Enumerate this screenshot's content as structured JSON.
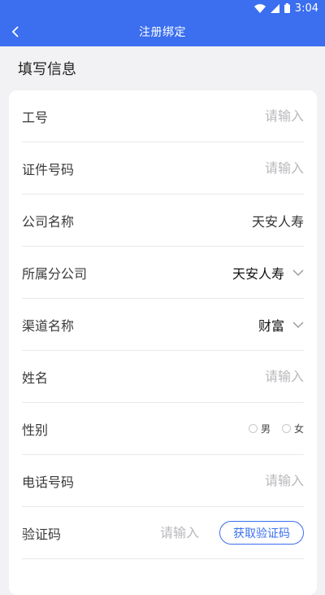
{
  "status_bar": {
    "time": "3:04",
    "icons": [
      "wifi-icon",
      "cell-signal-icon",
      "battery-icon"
    ]
  },
  "navbar": {
    "title": "注册绑定",
    "back_icon": "chevron-left-icon"
  },
  "section": {
    "title": "填写信息"
  },
  "form": {
    "employee_id": {
      "label": "工号",
      "placeholder": "请输入",
      "value": ""
    },
    "id_number": {
      "label": "证件号码",
      "placeholder": "请输入",
      "value": ""
    },
    "company": {
      "label": "公司名称",
      "value": "天安人寿"
    },
    "branch": {
      "label": "所属分公司",
      "value": "天安人寿"
    },
    "channel": {
      "label": "渠道名称",
      "value": "财富"
    },
    "name": {
      "label": "姓名",
      "placeholder": "请输入",
      "value": ""
    },
    "gender": {
      "label": "性别",
      "options": [
        "男",
        "女"
      ],
      "selected": null
    },
    "phone": {
      "label": "电话号码",
      "placeholder": "请输入",
      "value": ""
    },
    "verify_code": {
      "label": "验证码",
      "placeholder": "请输入",
      "value": "",
      "button_label": "获取验证码"
    }
  },
  "colors": {
    "primary": "#3b6ff0",
    "background": "#f2f2f4",
    "placeholder": "#b8b8bc"
  }
}
